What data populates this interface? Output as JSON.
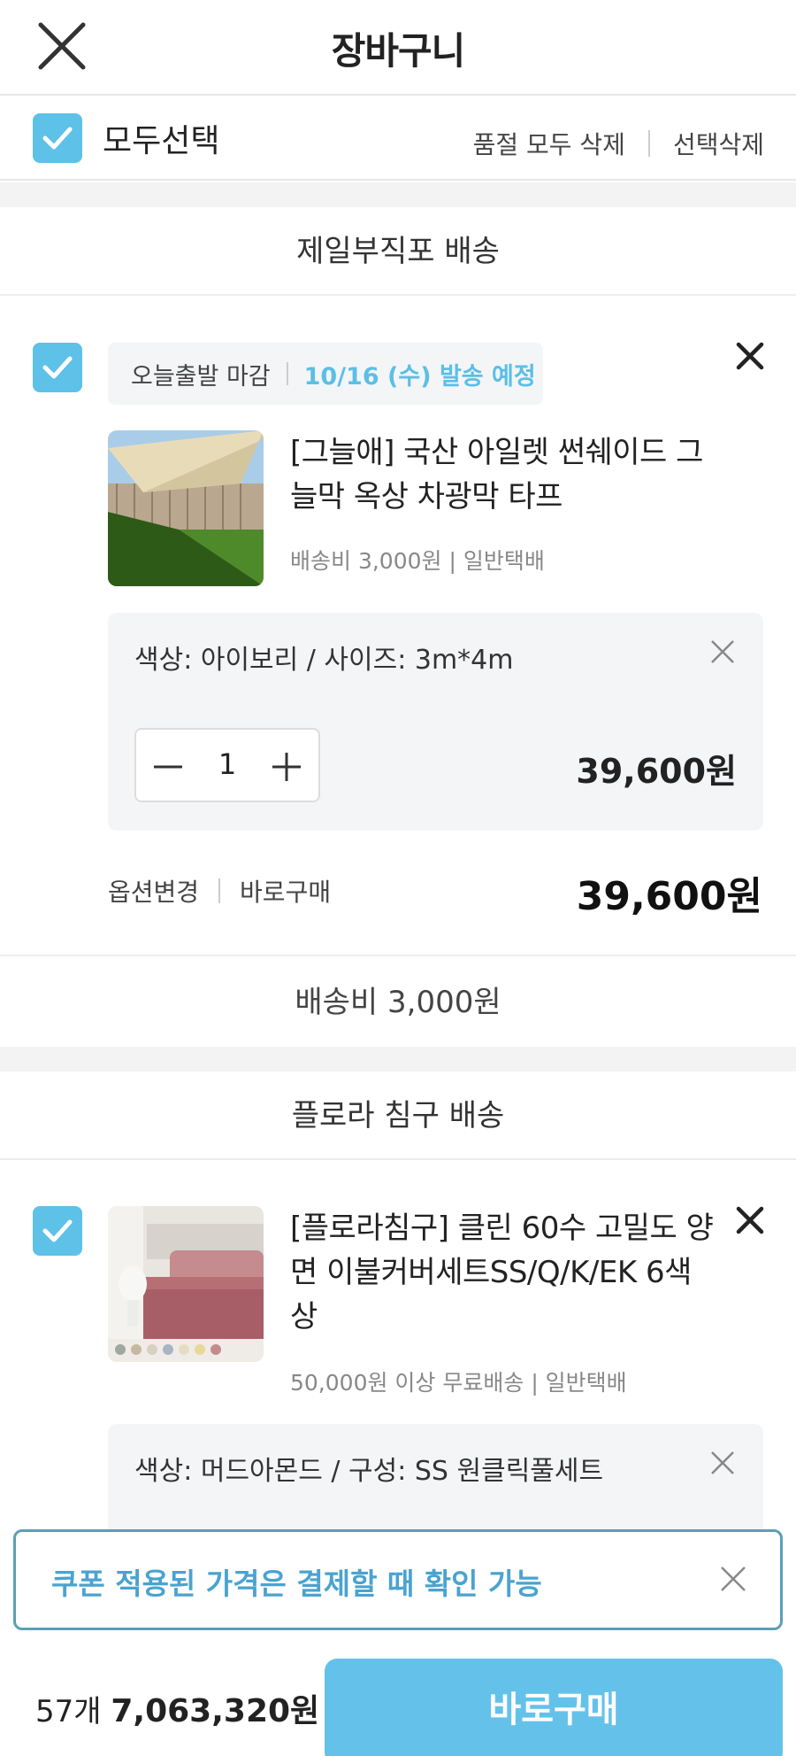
{
  "header": {
    "title": "장바구니"
  },
  "select_bar": {
    "select_all_label": "모두선택",
    "delete_soldout_label": "품절 모두 삭제",
    "delete_selected_label": "선택삭제"
  },
  "shops": [
    {
      "name": "제일부직포 배송",
      "items": [
        {
          "tag_cutoff": "오늘출발 마감",
          "tag_ship_date": "10/16 (수) 발송 예정",
          "title": "[그늘애] 국산 아일렛 썬쉐이드 그늘막 옥상 차광막 타프",
          "title_line1": "[그늘애] 국산 아일렛 썬쉐이드 그",
          "title_line2": "늘막 옥상 차광막 타프",
          "shipping_info": "배송비 3,000원 | 일반택배",
          "option_label": "색상: 아이보리 / 사이즈: 3m*4m",
          "quantity": "1",
          "option_price": "39,600원",
          "change_option_label": "옵션변경",
          "buy_now_label": "바로구매",
          "item_total": "39,600원"
        }
      ],
      "shipping_fee": "배송비 3,000원"
    },
    {
      "name": "플로라 침구 배송",
      "items": [
        {
          "title": "[플로라침구] 클린 60수 고밀도 양면 이불커버세트SS/Q/K/EK 6색상",
          "title_line1": "[플로라침구] 클린 60수 고밀도 양",
          "title_line2": "면 이불커버세트SS/Q/K/EK 6색",
          "title_line3": "상",
          "shipping_info": "50,000원 이상 무료배송 | 일반택배",
          "option_label": "색상: 머드아몬드 / 구성: SS 원클릭풀세트"
        }
      ]
    }
  ],
  "coupon_notice": {
    "text": "쿠폰 적용된 가격은 결제할 때 확인 가능"
  },
  "bottom_bar": {
    "count_label": "57개",
    "total_price": "7,063,320원",
    "buy_button_label": "바로구매"
  },
  "colors": {
    "accent": "#5dc1e8",
    "ship_date": "#5bbfe6",
    "coupon_text": "#4aa3cf",
    "coupon_border": "#5c9fb5"
  }
}
